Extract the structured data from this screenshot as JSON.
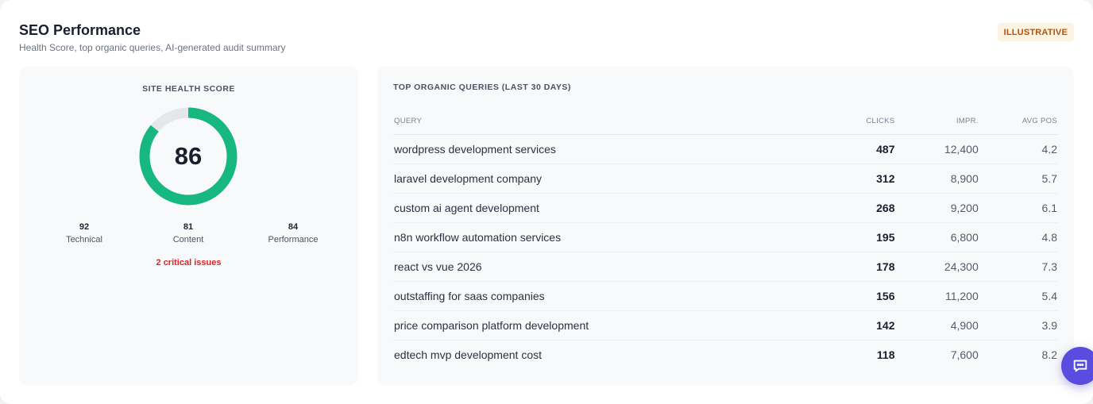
{
  "header": {
    "title": "SEO Performance",
    "subtitle": "Health Score, top organic queries, AI-generated audit summary",
    "badge": "ILLUSTRATIVE"
  },
  "health": {
    "label": "SITE HEALTH SCORE",
    "score": "86",
    "score_fraction": 0.86,
    "metrics": [
      {
        "value": "92",
        "label": "Technical"
      },
      {
        "value": "81",
        "label": "Content"
      },
      {
        "value": "84",
        "label": "Performance"
      }
    ],
    "critical": "2 critical issues"
  },
  "queries": {
    "label": "TOP ORGANIC QUERIES (LAST 30 DAYS)",
    "columns": {
      "query": "QUERY",
      "clicks": "CLICKS",
      "impr": "IMPR.",
      "pos": "AVG POS"
    },
    "rows": [
      {
        "query": "wordpress development services",
        "clicks": "487",
        "impr": "12,400",
        "pos": "4.2"
      },
      {
        "query": "laravel development company",
        "clicks": "312",
        "impr": "8,900",
        "pos": "5.7"
      },
      {
        "query": "custom ai agent development",
        "clicks": "268",
        "impr": "9,200",
        "pos": "6.1"
      },
      {
        "query": "n8n workflow automation services",
        "clicks": "195",
        "impr": "6,800",
        "pos": "4.8"
      },
      {
        "query": "react vs vue 2026",
        "clicks": "178",
        "impr": "24,300",
        "pos": "7.3"
      },
      {
        "query": "outstaffing for saas companies",
        "clicks": "156",
        "impr": "11,200",
        "pos": "5.4"
      },
      {
        "query": "price comparison platform development",
        "clicks": "142",
        "impr": "4,900",
        "pos": "3.9"
      },
      {
        "query": "edtech mvp development cost",
        "clicks": "118",
        "impr": "7,600",
        "pos": "8.2"
      }
    ]
  },
  "colors": {
    "gauge_fill": "#16b87f",
    "gauge_track": "#e5e7eb",
    "critical": "#dc2626",
    "accent": "#5b4ce0"
  },
  "chat": {
    "icon": "chat-bubble-icon"
  }
}
